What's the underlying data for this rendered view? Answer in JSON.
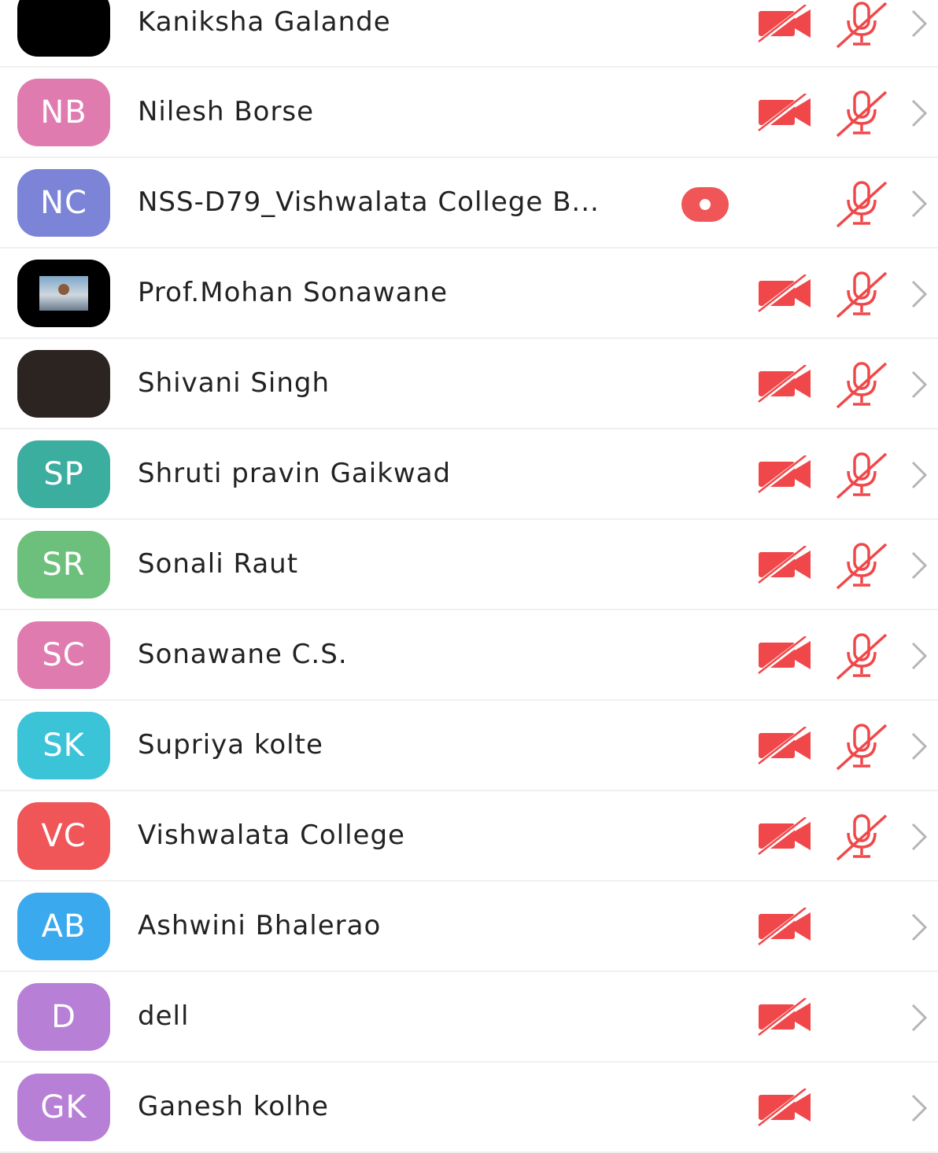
{
  "participants": [
    {
      "name": "Kaniksha Galande",
      "initials": "",
      "avatar_color": "#000000",
      "avatar_type": "black",
      "video_off": true,
      "mic_muted": true,
      "recording": false
    },
    {
      "name": "Nilesh Borse",
      "initials": "NB",
      "avatar_color": "#e07bb0",
      "avatar_type": "initials",
      "video_off": true,
      "mic_muted": true,
      "recording": false
    },
    {
      "name": "NSS-D79_Vishwalata College B...",
      "initials": "NC",
      "avatar_color": "#7b84d6",
      "avatar_type": "initials",
      "video_off": false,
      "mic_muted": true,
      "recording": true
    },
    {
      "name": "Prof.Mohan Sonawane",
      "initials": "",
      "avatar_color": "#000000",
      "avatar_type": "photo-man",
      "video_off": true,
      "mic_muted": true,
      "recording": false
    },
    {
      "name": "Shivani Singh",
      "initials": "",
      "avatar_color": "#2b2420",
      "avatar_type": "photo-woman",
      "video_off": true,
      "mic_muted": true,
      "recording": false
    },
    {
      "name": "Shruti pravin Gaikwad",
      "initials": "SP",
      "avatar_color": "#3cae9f",
      "avatar_type": "initials",
      "video_off": true,
      "mic_muted": true,
      "recording": false
    },
    {
      "name": "Sonali Raut",
      "initials": "SR",
      "avatar_color": "#6cc07c",
      "avatar_type": "initials",
      "video_off": true,
      "mic_muted": true,
      "recording": false
    },
    {
      "name": "Sonawane C.S.",
      "initials": "SC",
      "avatar_color": "#e07bb0",
      "avatar_type": "initials",
      "video_off": true,
      "mic_muted": true,
      "recording": false
    },
    {
      "name": "Supriya kolte",
      "initials": "SK",
      "avatar_color": "#3bc3d8",
      "avatar_type": "initials",
      "video_off": true,
      "mic_muted": true,
      "recording": false
    },
    {
      "name": "Vishwalata College",
      "initials": "VC",
      "avatar_color": "#f05558",
      "avatar_type": "initials",
      "video_off": true,
      "mic_muted": true,
      "recording": false
    },
    {
      "name": "Ashwini Bhalerao",
      "initials": "AB",
      "avatar_color": "#3aa9ee",
      "avatar_type": "initials",
      "video_off": true,
      "mic_muted": false,
      "recording": false
    },
    {
      "name": "dell",
      "initials": "D",
      "avatar_color": "#b77fd6",
      "avatar_type": "initials",
      "video_off": true,
      "mic_muted": false,
      "recording": false
    },
    {
      "name": "Ganesh kolhe",
      "initials": "GK",
      "avatar_color": "#b77fd6",
      "avatar_type": "initials",
      "video_off": true,
      "mic_muted": false,
      "recording": false
    }
  ],
  "icons": {
    "video": "video-off-icon",
    "mic": "mic-muted-icon",
    "chevron": "chevron-right-icon",
    "record": "recording-icon"
  },
  "colors": {
    "status_red": "#f0484a",
    "chevron_gray": "#b5b5b5",
    "divider": "#f0f0f0"
  }
}
